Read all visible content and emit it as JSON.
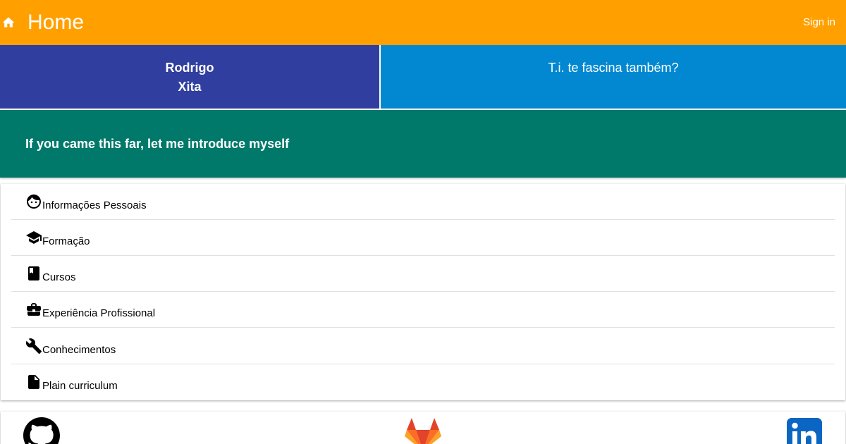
{
  "header": {
    "title": "Home",
    "signin_label": "Sign in"
  },
  "profile": {
    "first_name": "Rodrigo",
    "last_name": "Xita",
    "tagline": "T.i. te fascina também?"
  },
  "intro": {
    "text": "If you came this far, let me introduce myself"
  },
  "menu": {
    "items": [
      {
        "icon": "face-icon",
        "label": "Informações Pessoais"
      },
      {
        "icon": "school-icon",
        "label": "Formação"
      },
      {
        "icon": "book-icon",
        "label": "Cursos"
      },
      {
        "icon": "work-icon",
        "label": "Experiência Profissional"
      },
      {
        "icon": "build-icon",
        "label": "Conhecimentos"
      },
      {
        "icon": "file-icon",
        "label": "Plain curriculum"
      }
    ]
  },
  "social": {
    "links": [
      {
        "icon": "github-icon"
      },
      {
        "icon": "gitlab-icon"
      },
      {
        "icon": "linkedin-icon"
      }
    ]
  },
  "colors": {
    "topbar": "#ffa000",
    "name_card": "#303f9f",
    "tagline_card": "#0288d1",
    "intro_band": "#00796b",
    "linkedin": "#0a66c2",
    "gitlab": "#e24329"
  }
}
